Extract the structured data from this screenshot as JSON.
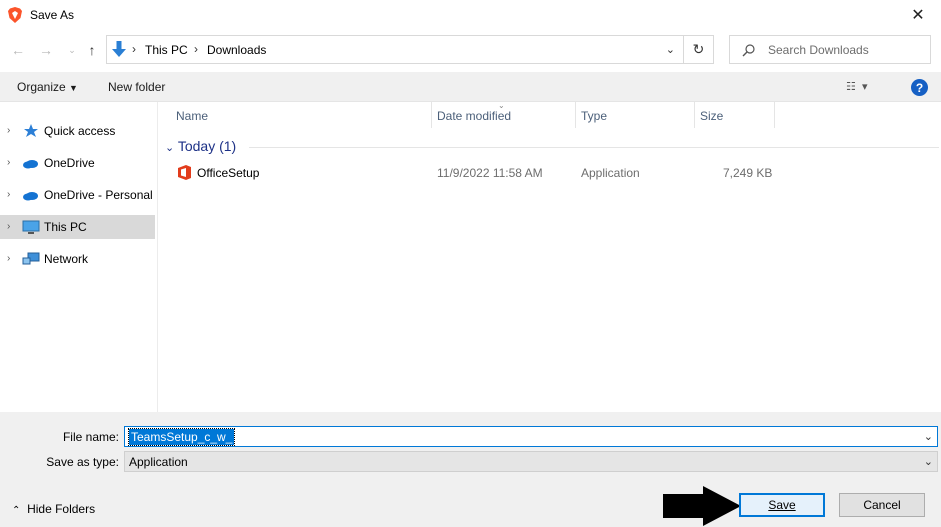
{
  "window": {
    "title": "Save As",
    "close_icon": "close-icon"
  },
  "nav": {
    "breadcrumb": [
      "This PC",
      "Downloads"
    ],
    "search_placeholder": "Search Downloads"
  },
  "toolbar": {
    "organize": "Organize",
    "new_folder": "New folder",
    "help": "?"
  },
  "sidebar": {
    "items": [
      {
        "label": "Quick access",
        "icon": "star-icon"
      },
      {
        "label": "OneDrive",
        "icon": "cloud-icon"
      },
      {
        "label": "OneDrive - Personal",
        "icon": "cloud-icon"
      },
      {
        "label": "This PC",
        "icon": "computer-icon",
        "selected": true
      },
      {
        "label": "Network",
        "icon": "network-icon"
      }
    ]
  },
  "list": {
    "columns": [
      "Name",
      "Date modified",
      "Type",
      "Size"
    ],
    "group": "Today (1)",
    "rows": [
      {
        "name": "OfficeSetup",
        "date": "11/9/2022 11:58 AM",
        "type": "Application",
        "size": "7,249 KB"
      }
    ]
  },
  "form": {
    "file_name_label": "File name:",
    "file_name_value": "TeamsSetup_c_w_",
    "save_type_label": "Save as type:",
    "save_type_value": "Application"
  },
  "footer": {
    "hide_folders": "Hide Folders",
    "save": "Save",
    "cancel": "Cancel"
  },
  "colors": {
    "accent": "#0078d7",
    "group_heading": "#1e3287",
    "selection": "#d9d9d9"
  }
}
